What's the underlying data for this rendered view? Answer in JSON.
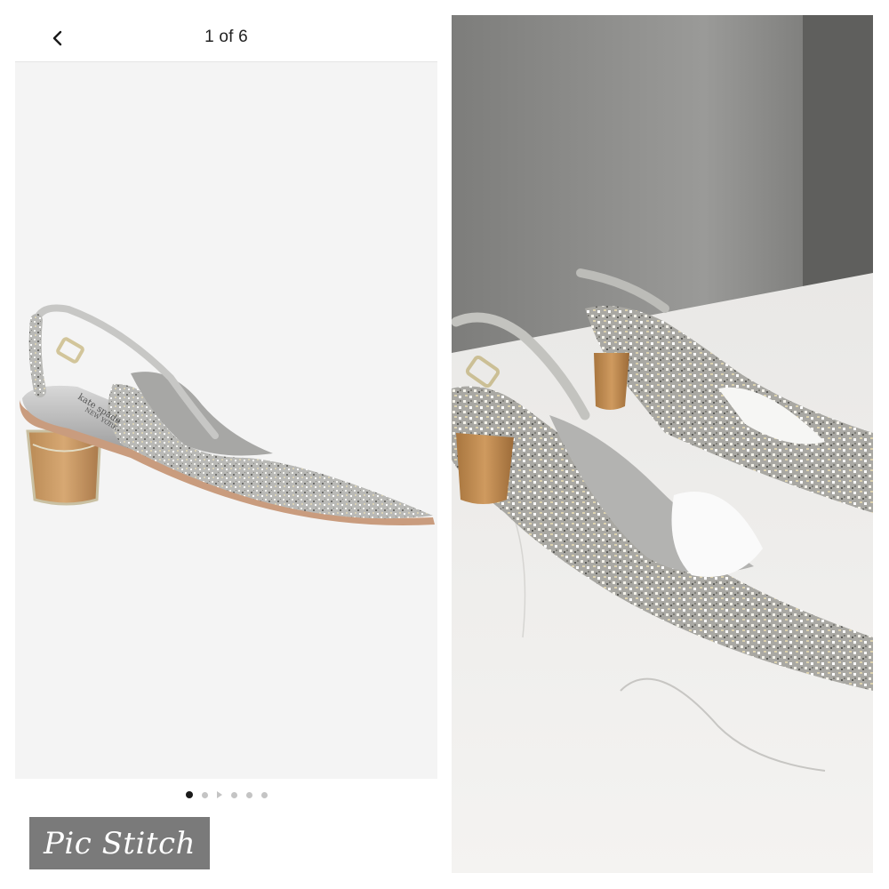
{
  "header": {
    "back_icon": "chevron-left-icon",
    "counter": "1 of 6"
  },
  "carousel": {
    "total": 6,
    "active_index": 0,
    "indicators": [
      "dot",
      "dot",
      "play",
      "dot",
      "dot",
      "dot"
    ]
  },
  "product_image": {
    "insole_text_line1": "kate spade",
    "insole_text_line2": "NEW YORK"
  },
  "watermark": {
    "text": "Pic Stitch"
  },
  "colors": {
    "panel_bg": "#f4f4f4",
    "active_dot": "#1a1a1a",
    "inactive_dot": "#c4c4c4",
    "watermark_bg": "#7a7a7a"
  }
}
